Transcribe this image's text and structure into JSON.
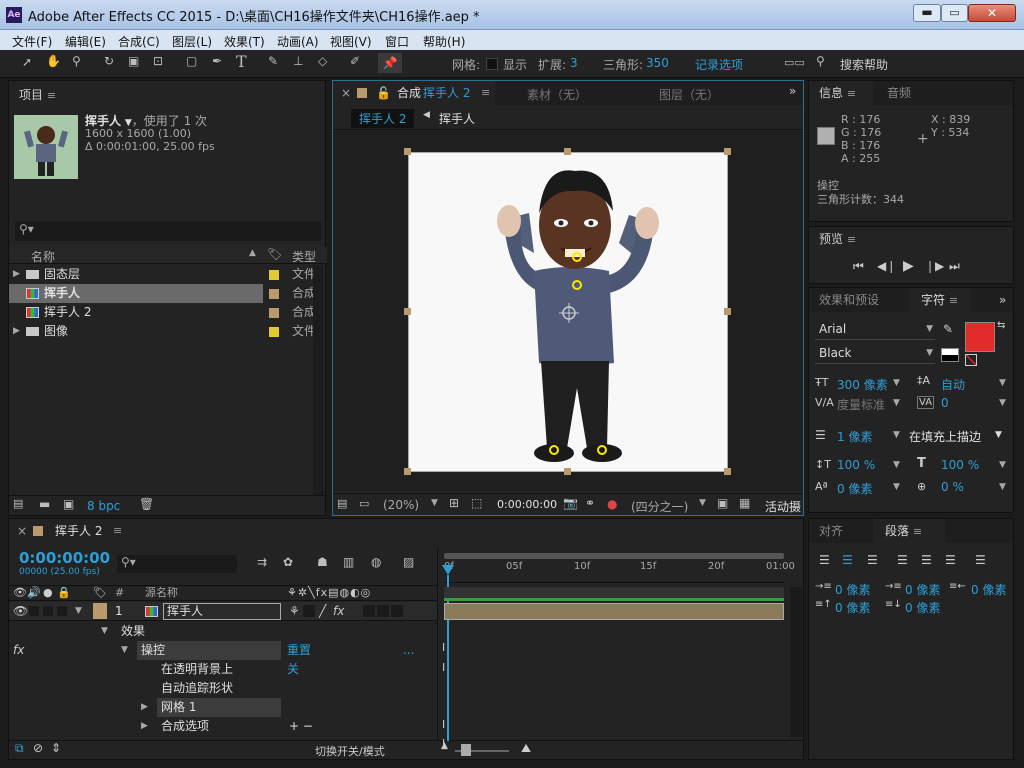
{
  "window": {
    "title": "Adobe After Effects CC 2015 - D:\\桌面\\CH16操作文件夹\\CH16操作.aep *",
    "app_icon": "Ae"
  },
  "menu": [
    "文件(F)",
    "编辑(E)",
    "合成(C)",
    "图层(L)",
    "效果(T)",
    "动画(A)",
    "视图(V)",
    "窗口",
    "帮助(H)"
  ],
  "toolbar": {
    "grid_label": "网格:",
    "show_label": "显示",
    "expand_label": "扩展:",
    "expand_value": "3",
    "triangle_label": "三角形:",
    "triangle_value": "350",
    "record_options": "记录选项",
    "search_help": "搜索帮助"
  },
  "project": {
    "title": "项目",
    "item_name": "挥手人",
    "used_text": "，使用了 1 次",
    "size_text": "1600 x 1600 (1.00)",
    "duration_text": "Δ 0:00:01:00, 25.00 fps",
    "col_name": "名称",
    "col_type": "类型",
    "items": [
      {
        "name": "固态层",
        "type": "文件",
        "color": "#e2c833",
        "kind": "folder"
      },
      {
        "name": "挥手人",
        "type": "合成",
        "color": "#b89a6c",
        "kind": "comp",
        "selected": true
      },
      {
        "name": "挥手人 2",
        "type": "合成",
        "color": "#b89a6c",
        "kind": "comp"
      },
      {
        "name": "图像",
        "type": "文件",
        "color": "#e2c833",
        "kind": "folder"
      }
    ],
    "bpc": "8 bpc"
  },
  "comp": {
    "tab_prefix": "合成",
    "tab_name": "挥手人 2",
    "tab_footage": "素材（无）",
    "tab_layer": "图层（无）",
    "crumb_active": "挥手人 2",
    "crumb_child": "挥手人",
    "zoom": "(20%)",
    "timecode": "0:00:00:00",
    "quality": "(四分之一)",
    "camera": "活动摄"
  },
  "info": {
    "title": "信息",
    "audio": "音频",
    "r": "R : 176",
    "g": "G : 176",
    "b": "B : 176",
    "a": "A : 255",
    "x": "X : 839",
    "y": "Y : 534",
    "msg1": "操控",
    "msg2": "三角形计数：344"
  },
  "preview": {
    "title": "预览"
  },
  "character": {
    "tab_effects": "效果和预设",
    "tab_char": "字符",
    "font": "Arial",
    "style": "Black",
    "size": "300 像素",
    "leading": "自动",
    "kerning": "度量标准",
    "tracking": "0",
    "stroke_w": "1 像素",
    "stroke_type": "在填充上描边",
    "vscale": "100 %",
    "hscale": "100 %",
    "baseline": "0 像素",
    "tsume": "0 %",
    "fill_color": "#e22c2c"
  },
  "paragraph": {
    "tab_align": "对齐",
    "tab_para": "段落",
    "indent_l": "0 像素",
    "indent_first": "0 像素",
    "indent_r": "0 像素",
    "space_before": "0 像素",
    "space_after": "0 像素"
  },
  "timeline": {
    "tab_name": "挥手人 2",
    "timecode": "0:00:00:00",
    "frames": "00000 (25.00 fps)",
    "col_source": "源名称",
    "layer_num": "1",
    "layer_name": "挥手人",
    "ruler": [
      "0f",
      "05f",
      "10f",
      "15f",
      "20f",
      "01:00"
    ],
    "props": [
      {
        "label": "效果",
        "indent": 1,
        "arrow": "▼"
      },
      {
        "label": "操控",
        "indent": 2,
        "arrow": "▼",
        "value": "重置",
        "extra": "...",
        "fx": true,
        "hl": true
      },
      {
        "label": "在透明背景上",
        "indent": 3,
        "value": "关"
      },
      {
        "label": "自动追踪形状",
        "indent": 3
      },
      {
        "label": "网格 1",
        "indent": 3,
        "arrow": "▶",
        "hl": true
      },
      {
        "label": "合成选项",
        "indent": 3,
        "arrow": "▶",
        "value": "+ −"
      }
    ],
    "toggle_label": "切换开关/模式"
  }
}
